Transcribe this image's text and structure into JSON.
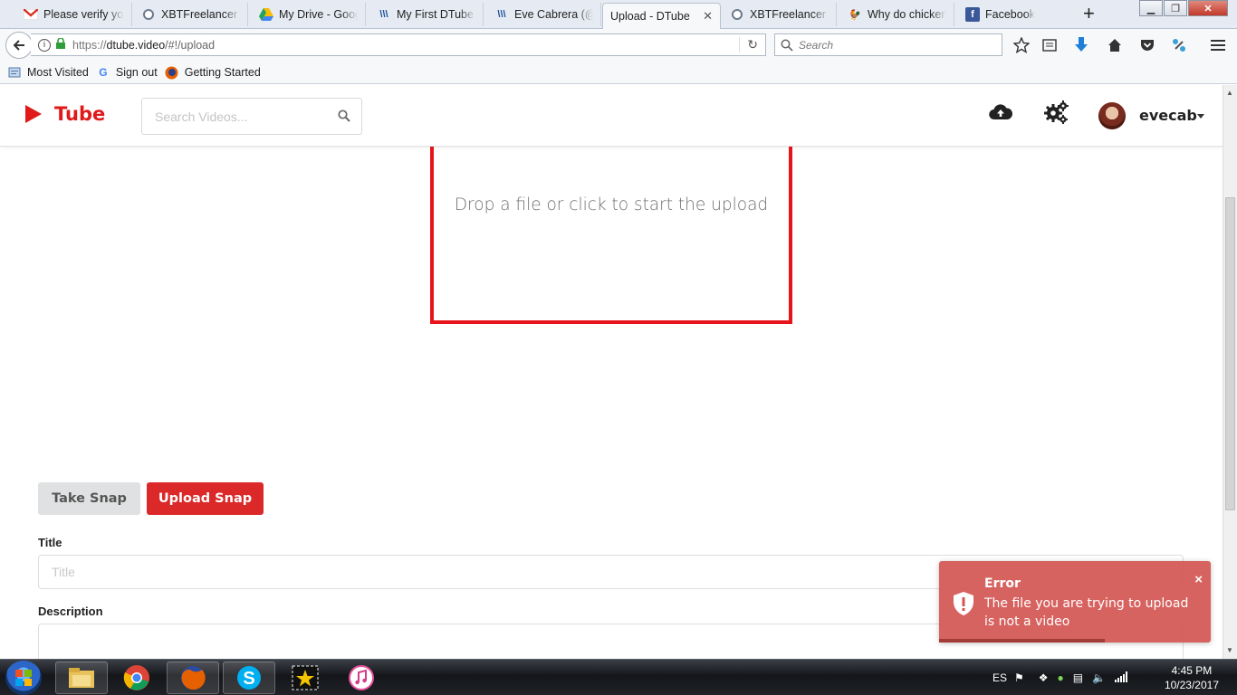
{
  "browser": {
    "tabs": [
      {
        "label": "Please verify you",
        "icon": "gmail-icon"
      },
      {
        "label": "XBTFreelancer | N",
        "icon": "xbt-icon"
      },
      {
        "label": "My Drive - Googl",
        "icon": "drive-icon"
      },
      {
        "label": "My First DTube V",
        "icon": "steemit-icon"
      },
      {
        "label": "Eve Cabrera (@e",
        "icon": "steemit-icon"
      },
      {
        "label": "Upload - DTube",
        "icon": "",
        "active": true
      },
      {
        "label": "XBTFreelancer | N",
        "icon": "xbt-icon"
      },
      {
        "label": "Why do chickens",
        "icon": "chicken-icon"
      },
      {
        "label": "Facebook",
        "icon": "facebook-icon"
      }
    ],
    "url_prefix": "https://",
    "url_host": "dtube.video",
    "url_path": "/#!/upload",
    "search_placeholder": "Search",
    "bookmarks": [
      {
        "label": "Most Visited",
        "icon": "bookmarks-folder-icon"
      },
      {
        "label": "Sign out",
        "icon": "google-icon"
      },
      {
        "label": "Getting Started",
        "icon": "firefox-icon"
      }
    ]
  },
  "app": {
    "logo_text": "Tube",
    "search_placeholder": "Search Videos...",
    "username": "evecab"
  },
  "upload": {
    "dropzone_text": "Drop a file or click to start the upload",
    "take_snap": "Take Snap",
    "upload_snap": "Upload Snap",
    "title_label": "Title",
    "title_placeholder": "Title",
    "description_label": "Description"
  },
  "toast": {
    "title": "Error",
    "message": "The file you are trying to upload is not a video",
    "close": "×"
  },
  "taskbar": {
    "language": "ES",
    "time": "4:45 PM",
    "date": "10/23/2017"
  },
  "colors": {
    "brand_red": "#e01a1a",
    "upload_button": "#db2828",
    "toast_bg": "#d45652"
  }
}
